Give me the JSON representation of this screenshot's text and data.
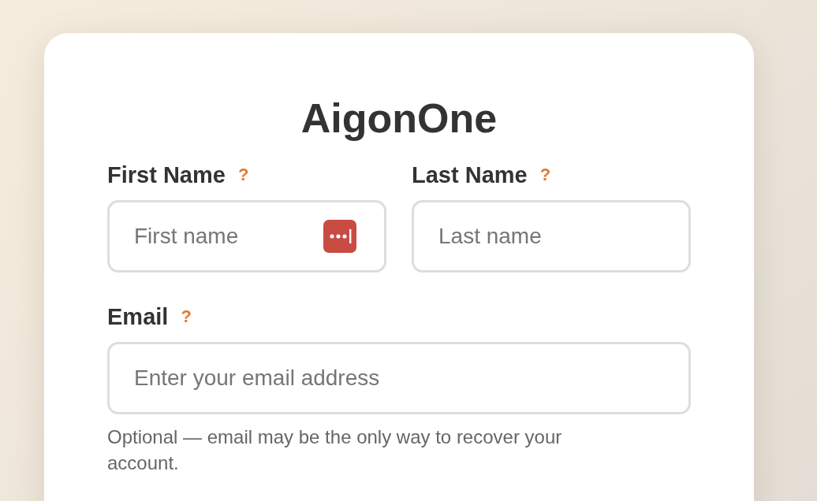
{
  "title": "AigonOne",
  "name_fields": [
    {
      "label": "First Name",
      "help": "?",
      "placeholder": "First name",
      "autofill_icon": true
    },
    {
      "label": "Last Name",
      "help": "?",
      "placeholder": "Last name",
      "autofill_icon": false
    }
  ],
  "email_field": {
    "label": "Email",
    "help": "?",
    "placeholder": "Enter your email address",
    "hint": "Optional — email may be the only way to recover your account."
  }
}
